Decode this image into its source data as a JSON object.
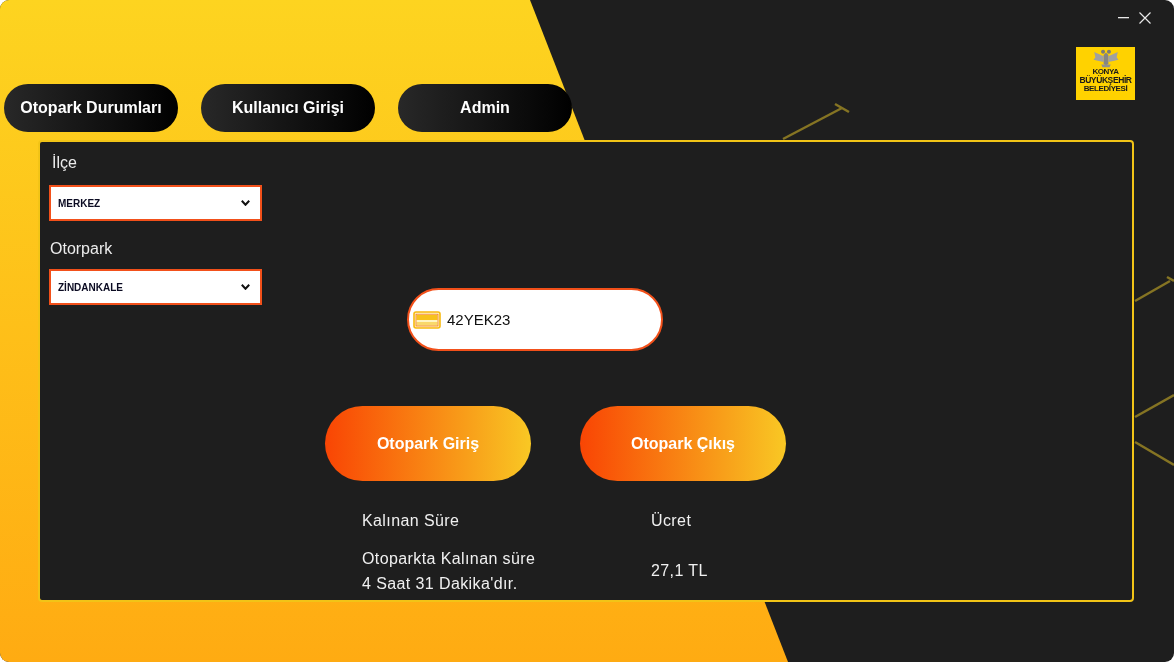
{
  "window": {
    "controls": [
      {
        "kind": "minimize"
      },
      {
        "kind": "close"
      }
    ]
  },
  "logo": {
    "lines": [
      "KONYA",
      "BÜYÜKŞEHİR",
      "BELEDİYESİ"
    ]
  },
  "nav": [
    {
      "label": "Otopark Durumları"
    },
    {
      "label": "Kullanıcı Girişi"
    },
    {
      "label": "Admin"
    }
  ],
  "form": {
    "fields": [
      {
        "label": "İlçe",
        "value": "MERKEZ"
      },
      {
        "label": "Otorpark",
        "value": "ZİNDANKALE"
      }
    ],
    "plate": {
      "value": "42YEK23"
    }
  },
  "actions": [
    {
      "label": "Otopark Giriş"
    },
    {
      "label": "Otopark Çıkış"
    }
  ],
  "result": {
    "duration": {
      "label": "Kalınan Süre",
      "text": "Otoparkta Kalınan süre\n4 Saat 31 Dakika'dır."
    },
    "fee": {
      "label": "Ücret",
      "value": "27,1 TL"
    }
  }
}
